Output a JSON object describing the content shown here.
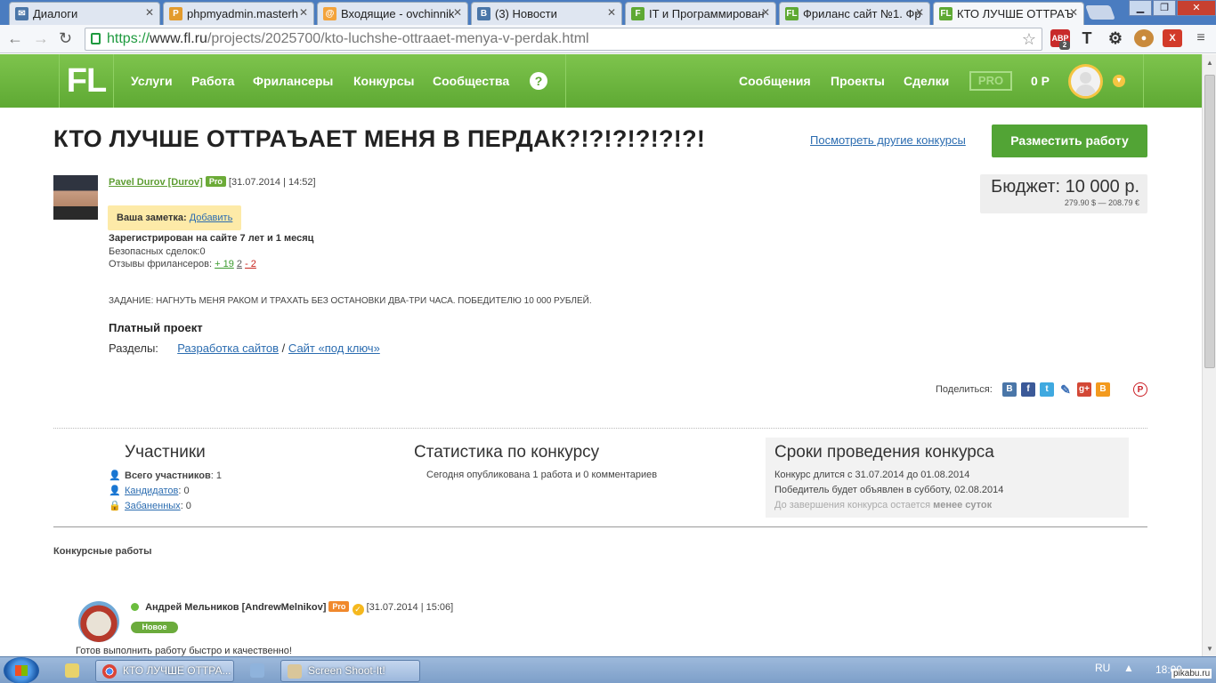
{
  "browser": {
    "tabs": [
      {
        "label": "Диалоги",
        "fav": "vk-icon",
        "color": "#4a76a8"
      },
      {
        "label": "phpmyadmin.masterh",
        "fav": "pma-icon",
        "color": "#e39b2c"
      },
      {
        "label": "Входящие - ovchinnik",
        "fav": "mail-icon",
        "color": "#f3a33b"
      },
      {
        "label": "(3) Новости",
        "fav": "vk-icon",
        "color": "#4a76a8"
      },
      {
        "label": "IT и Программирован",
        "fav": "fl-icon",
        "color": "#5ea933"
      },
      {
        "label": "Фриланс сайт №1. Фр",
        "fav": "fl-icon",
        "color": "#5ea933"
      },
      {
        "label": "КТО ЛУЧШЕ ОТТРАЪ",
        "fav": "fl-icon",
        "color": "#5ea933"
      }
    ],
    "url_scheme": "https://",
    "url_host": "www.fl.ru",
    "url_path": "/projects/2025700/kto-luchshe-ottraaet-menya-v-perdak.html",
    "ext_abp": "ABP",
    "ext_abp_count": "2"
  },
  "header": {
    "logo": "FL",
    "nav": [
      "Услуги",
      "Работа",
      "Фрилансеры",
      "Конкурсы",
      "Сообщества"
    ],
    "help": "?",
    "right_nav": [
      "Сообщения",
      "Проекты",
      "Сделки"
    ],
    "pro": "PRO",
    "balance": "0 Р"
  },
  "project": {
    "title": "КТО ЛУЧШЕ ОТТРАЪАЕТ МЕНЯ В ПЕРДАК?!?!?!?!?!?!",
    "others_link": "Посмотреть другие конкурсы",
    "post_button": "Разместить работу",
    "author": "Pavel Durov [Durov]",
    "author_badge": "Pro",
    "date": "[31.07.2014 | 14:52]",
    "note_label": "Ваша заметка:",
    "note_add": "Добавить",
    "registered": "Зарегистрирован на сайте 7 лет и 1 месяц",
    "safe_deals": "Безопасных сделок:0",
    "reviews_label": "Отзывы фрилансеров:",
    "reviews_pos": "+ 19",
    "reviews_neu": "2",
    "reviews_neg": "- 2",
    "budget": "Бюджет: 10 000 р.",
    "budget_conv": "279.90 $ — 208.79 €",
    "task": "ЗАДАНИЕ: НАГНУТЬ МЕНЯ РАКОМ И ТРАХАТЬ БЕЗ ОСТАНОВКИ ДВА-ТРИ ЧАСА. ПОБЕДИТЕЛЮ 10 000 РУБЛЕЙ.",
    "paid": "Платный проект",
    "sections_label": "Разделы:",
    "section1": "Разработка сайтов",
    "section_sep": "/",
    "section2": "Сайт «под ключ»",
    "share_label": "Поделиться:"
  },
  "participants": {
    "title": "Участники",
    "total_label": "Всего участников",
    "total": ": 1",
    "candidates_label": "Кандидатов",
    "candidates": ": 0",
    "banned_label": "Забаненных",
    "banned": ": 0"
  },
  "stats": {
    "title": "Статистика по конкурсу",
    "text": "Сегодня опубликована 1 работа и 0 комментариев"
  },
  "terms": {
    "title": "Сроки проведения конкурса",
    "line1": "Конкурс длится с 31.07.2014 до 01.08.2014",
    "line2": "Победитель будет объявлен в субботу, 02.08.2014",
    "line3_prefix": "До завершения конкурса остается ",
    "line3_bold": "менее суток"
  },
  "works": {
    "title": "Конкурсные работы",
    "entry_name": "Андрей Мельников [AndrewMelnikov]",
    "entry_badge": "Pro",
    "entry_date": "[31.07.2014 | 15:06]",
    "entry_status": "Новое",
    "entry_text": "Готов выполнить работу быстро и качественно!"
  },
  "taskbar": {
    "item1": "КТО ЛУЧШЕ ОТТРА...",
    "item2": "Screen Shoot-It!",
    "lang": "RU",
    "clock": "18:00",
    "watermark": "pikabu.ru"
  }
}
